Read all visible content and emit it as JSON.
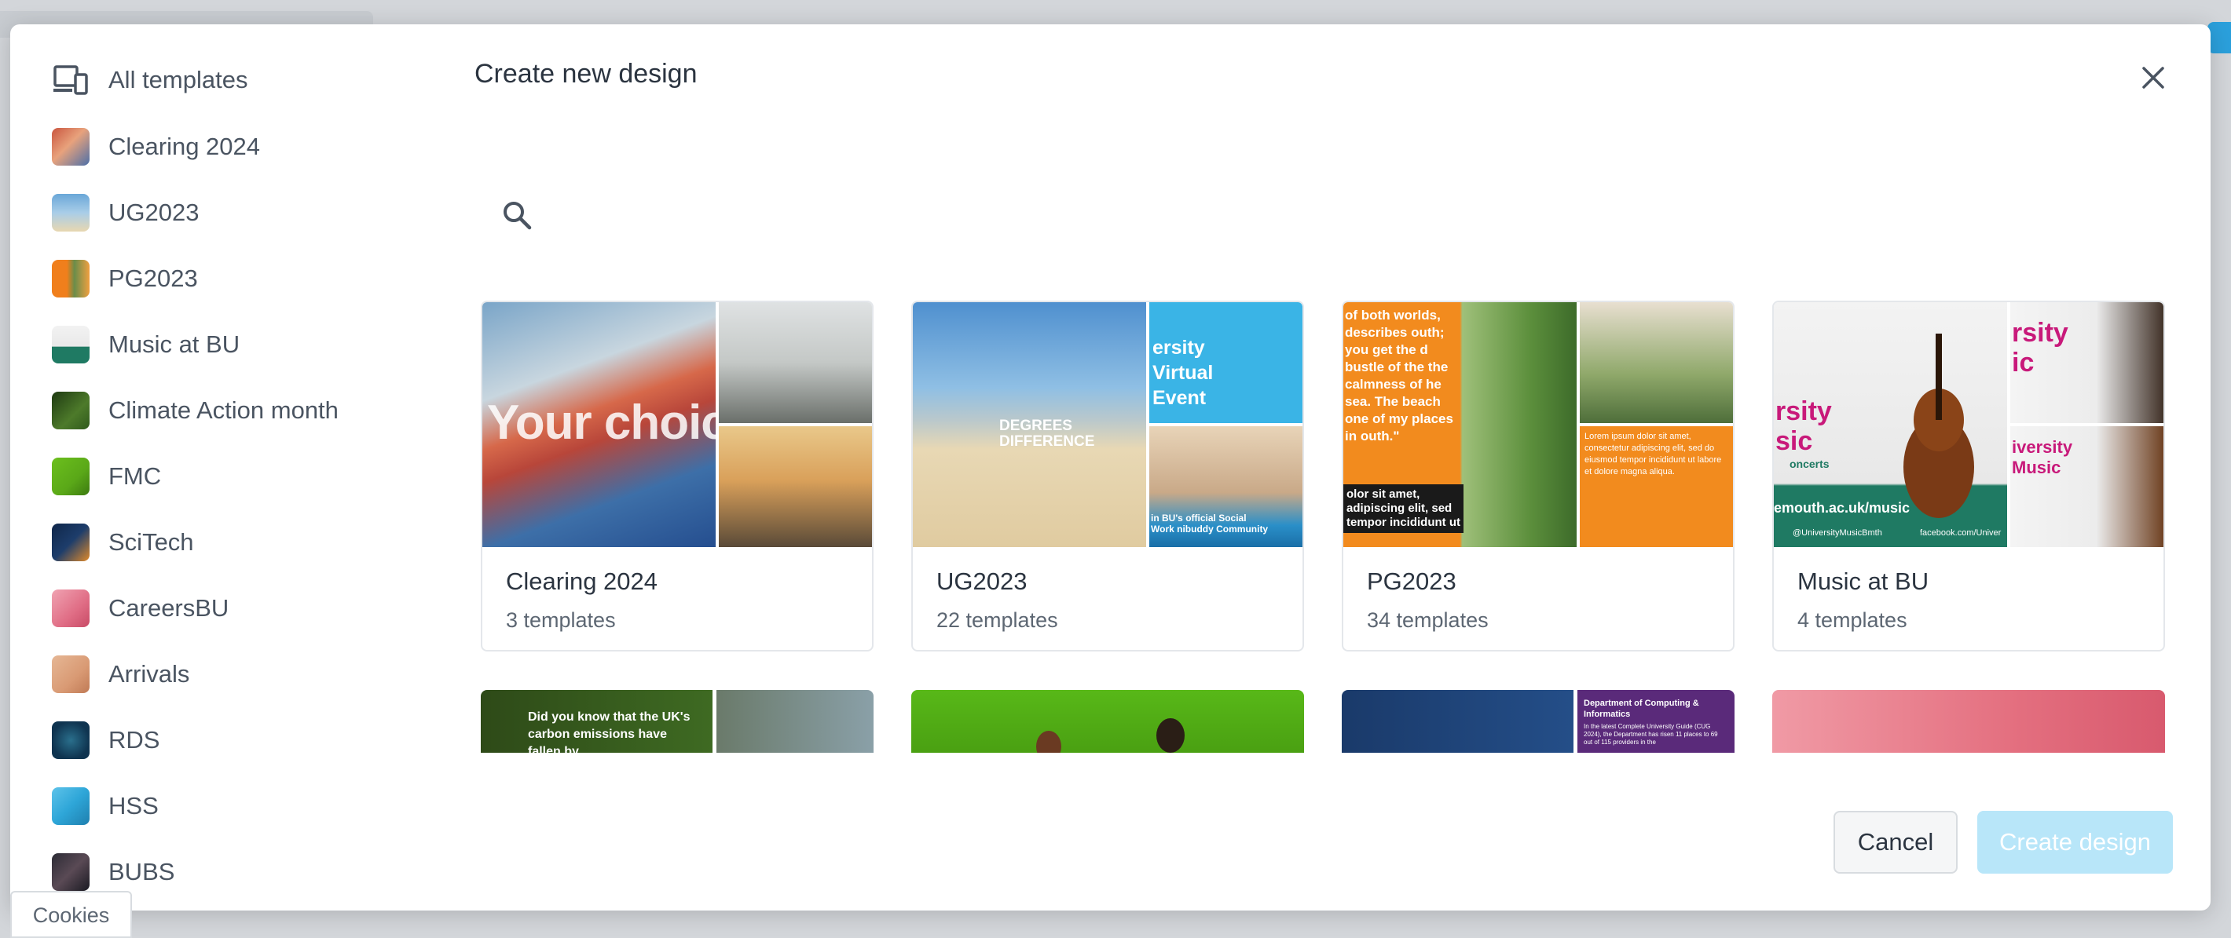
{
  "modal": {
    "title": "Create new design",
    "close_icon": "close-icon",
    "search": {
      "icon": "search-icon",
      "placeholder": "",
      "value": ""
    }
  },
  "sidebar": {
    "all_templates": {
      "label": "All templates",
      "icon": "devices-icon"
    },
    "items": [
      {
        "label": "Clearing 2024",
        "color": "#c9553f"
      },
      {
        "label": "UG2023",
        "color": "#6aa7d8"
      },
      {
        "label": "PG2023",
        "color": "#f07f1c"
      },
      {
        "label": "Music at BU",
        "color": "#1f7a63"
      },
      {
        "label": "Climate Action month",
        "color": "#2f5a1c"
      },
      {
        "label": "FMC",
        "color": "#6cbf1d"
      },
      {
        "label": "SciTech",
        "color": "#1d3d6b"
      },
      {
        "label": "CareersBU",
        "color": "#e06d85"
      },
      {
        "label": "Arrivals",
        "color": "#d99a74"
      },
      {
        "label": "RDS",
        "color": "#0f3450"
      },
      {
        "label": "HSS",
        "color": "#2ea6d8"
      },
      {
        "label": "BUBS",
        "color": "#2b2b35"
      }
    ]
  },
  "cards": [
    {
      "name": "Clearing 2024",
      "count": "3 templates",
      "overlay": "Your choice"
    },
    {
      "name": "UG2023",
      "count": "22 templates",
      "overlay": "DEGREES DIFFERENCE",
      "side_text": "ersity Virtual Event",
      "banner": "in BU's official Social Work nibuddy Community"
    },
    {
      "name": "PG2023",
      "count": "34 templates",
      "quote": "of both worlds, describes outh; you get the d bustle of the the calmness of he sea. The beach one of my places in outh.\"",
      "footnote": "olor sit amet, adipiscing elit, sed tempor incididunt ut",
      "side_quote": "Lorem ipsum dolor sit amet, consectetur adipiscing elit, sed do eiusmod tempor incididunt ut labore et dolore magna aliqua."
    },
    {
      "name": "Music at BU",
      "count": "4 templates",
      "overlay": "rsity sic",
      "overlay2": "oncerts",
      "side_text": "rsity ic",
      "side_text2": "iversity Music",
      "url": "emouth.ac.uk/music",
      "social": "@UniversityMusicBmth",
      "social2": "facebook.com/Univer"
    }
  ],
  "partial_cards": [
    {
      "text": "Did you know that the UK's carbon emissions have fallen by"
    },
    {
      "text": ""
    },
    {
      "text": "Department of Computing & Informatics",
      "sub": "In the latest Complete University Guide (CUG 2024), the Department has risen 11 places to 69 out of 115 providers in the"
    },
    {
      "text": ""
    }
  ],
  "footer": {
    "cancel_label": "Cancel",
    "create_label": "Create design"
  },
  "cookies_label": "Cookies"
}
